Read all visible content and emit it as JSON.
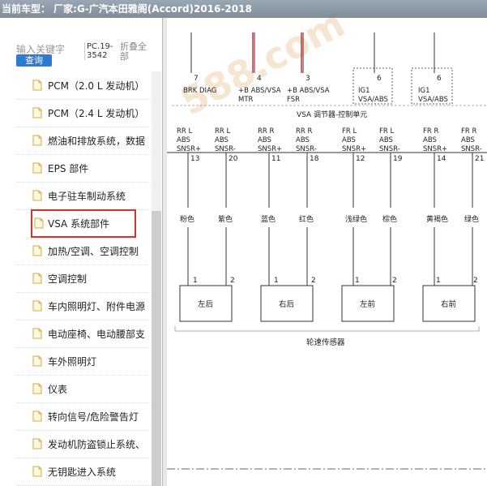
{
  "window": {
    "title": "当前车型： 厂家:G-广汽本田雅阁(Accord)2016-2018"
  },
  "search": {
    "label": "输入关键字",
    "button": "查询",
    "pc_code": "PC.19-3542",
    "fold_all": "折叠全部"
  },
  "tree": {
    "items": [
      {
        "label": "PCM（2.0 L 发动机）",
        "selected": false
      },
      {
        "label": "PCM（2.4 L 发动机）",
        "selected": false
      },
      {
        "label": "燃油和排放系统，数据",
        "selected": false
      },
      {
        "label": "EPS 部件",
        "selected": false
      },
      {
        "label": "电子驻车制动系统",
        "selected": false
      },
      {
        "label": "VSA 系统部件",
        "selected": true
      },
      {
        "label": "加热/空调、空调控制",
        "selected": false
      },
      {
        "label": "空调控制",
        "selected": false
      },
      {
        "label": "车内照明灯、附件电源",
        "selected": false
      },
      {
        "label": "电动座椅、电动腰部支",
        "selected": false
      },
      {
        "label": "车外照明灯",
        "selected": false
      },
      {
        "label": "仪表",
        "selected": false
      },
      {
        "label": "转向信号/危险警告灯",
        "selected": false
      },
      {
        "label": "发动机防盗锁止系统、",
        "selected": false
      },
      {
        "label": "无钥匙进入系统",
        "selected": false
      }
    ]
  },
  "diagram": {
    "top_pins": [
      "7",
      "4",
      "3",
      "6",
      "6"
    ],
    "top_labels": [
      [
        "BRK DIAG"
      ],
      [
        "+B ABS/VSA",
        "MTR"
      ],
      [
        "+B ABS/VSA",
        "FSR"
      ],
      [
        "IG1",
        "VSA/ABS"
      ],
      [
        "IG1",
        "VSA/ABS"
      ]
    ],
    "module_title": "VSA 调节器-控制单元",
    "signals": [
      {
        "name": [
          "RR L",
          "ABS",
          "SNSR+"
        ],
        "pin": "13",
        "wire": "粉色"
      },
      {
        "name": [
          "RR L",
          "ABS",
          "SNSR-"
        ],
        "pin": "20",
        "wire": "紫色"
      },
      {
        "name": [
          "RR R",
          "ABS",
          "SNSR+"
        ],
        "pin": "11",
        "wire": "蓝色"
      },
      {
        "name": [
          "RR R",
          "ABS",
          "SNSR-"
        ],
        "pin": "18",
        "wire": "红色"
      },
      {
        "name": [
          "FR L",
          "ABS",
          "SNSR+"
        ],
        "pin": "12",
        "wire": "浅绿色"
      },
      {
        "name": [
          "FR L",
          "ABS",
          "SNSR-"
        ],
        "pin": "19",
        "wire": "棕色"
      },
      {
        "name": [
          "FR R",
          "ABS",
          "SNSR+"
        ],
        "pin": "14",
        "wire": "黄褐色"
      },
      {
        "name": [
          "FR R",
          "ABS",
          "SNSR-"
        ],
        "pin": "21",
        "wire": "绿色"
      }
    ],
    "sensors": [
      {
        "label": "左后",
        "pins": [
          "1",
          "2"
        ]
      },
      {
        "label": "右后",
        "pins": [
          "1",
          "2"
        ]
      },
      {
        "label": "左前",
        "pins": [
          "1",
          "2"
        ]
      },
      {
        "label": "右前",
        "pins": [
          "1",
          "2"
        ]
      }
    ],
    "sensor_group": "轮速传感器",
    "watermark": "588.com",
    "colors": {
      "red_wire": "#cc2222",
      "line": "#333333",
      "selection": "#d9302c",
      "button": "#2d7ad6"
    }
  }
}
